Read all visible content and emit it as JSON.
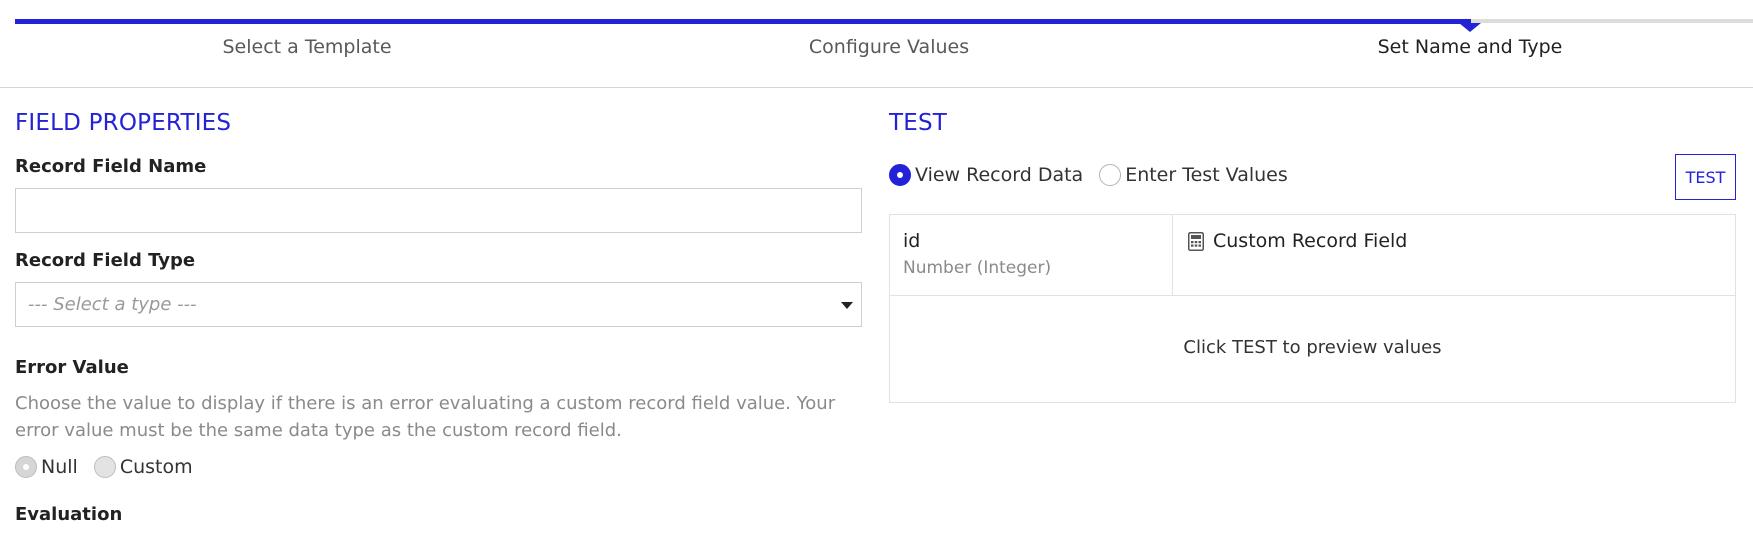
{
  "stepper": {
    "steps": [
      {
        "label": "Select a Template"
      },
      {
        "label": "Configure Values"
      },
      {
        "label": "Set Name and Type"
      }
    ],
    "active_step": 3,
    "progress_fraction": 0.84
  },
  "field_properties": {
    "title": "FIELD PROPERTIES",
    "name_label": "Record Field Name",
    "name_value": "",
    "type_label": "Record Field Type",
    "type_placeholder": "--- Select a type ---",
    "error_label": "Error Value",
    "error_help": "Choose the value to display if there is an error evaluating a custom record field value. Your error value must be the same data type as the custom record field.",
    "error_options": [
      {
        "label": "Null",
        "selected": true
      },
      {
        "label": "Custom",
        "selected": false
      }
    ],
    "evaluation_label": "Evaluation"
  },
  "test": {
    "title": "TEST",
    "mode_options": [
      {
        "label": "View Record Data",
        "selected": true
      },
      {
        "label": "Enter Test Values",
        "selected": false
      }
    ],
    "button_label": "TEST",
    "columns": [
      {
        "name": "id",
        "type": "Number (Integer)"
      },
      {
        "name": "Custom Record Field",
        "icon": "calculator-icon"
      }
    ],
    "empty_message": "Click TEST to preview values"
  },
  "colors": {
    "accent": "#2322d6",
    "text": "#222222",
    "muted": "#8a8a8a",
    "border": "#cfcfcf"
  }
}
